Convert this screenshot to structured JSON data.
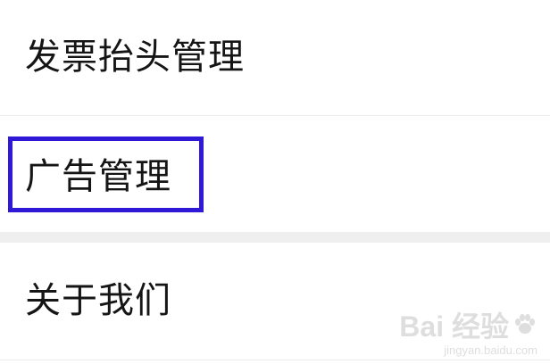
{
  "menu": {
    "items": [
      {
        "label": "发票抬头管理"
      },
      {
        "label": "广告管理"
      },
      {
        "label": "关于我们"
      }
    ]
  },
  "colors": {
    "highlight": "#2f18d6",
    "separator": "#efefef"
  },
  "watermark": {
    "brand": "Bai 经验",
    "url": "jingyan.baidu.com",
    "icon": "paw-icon"
  }
}
